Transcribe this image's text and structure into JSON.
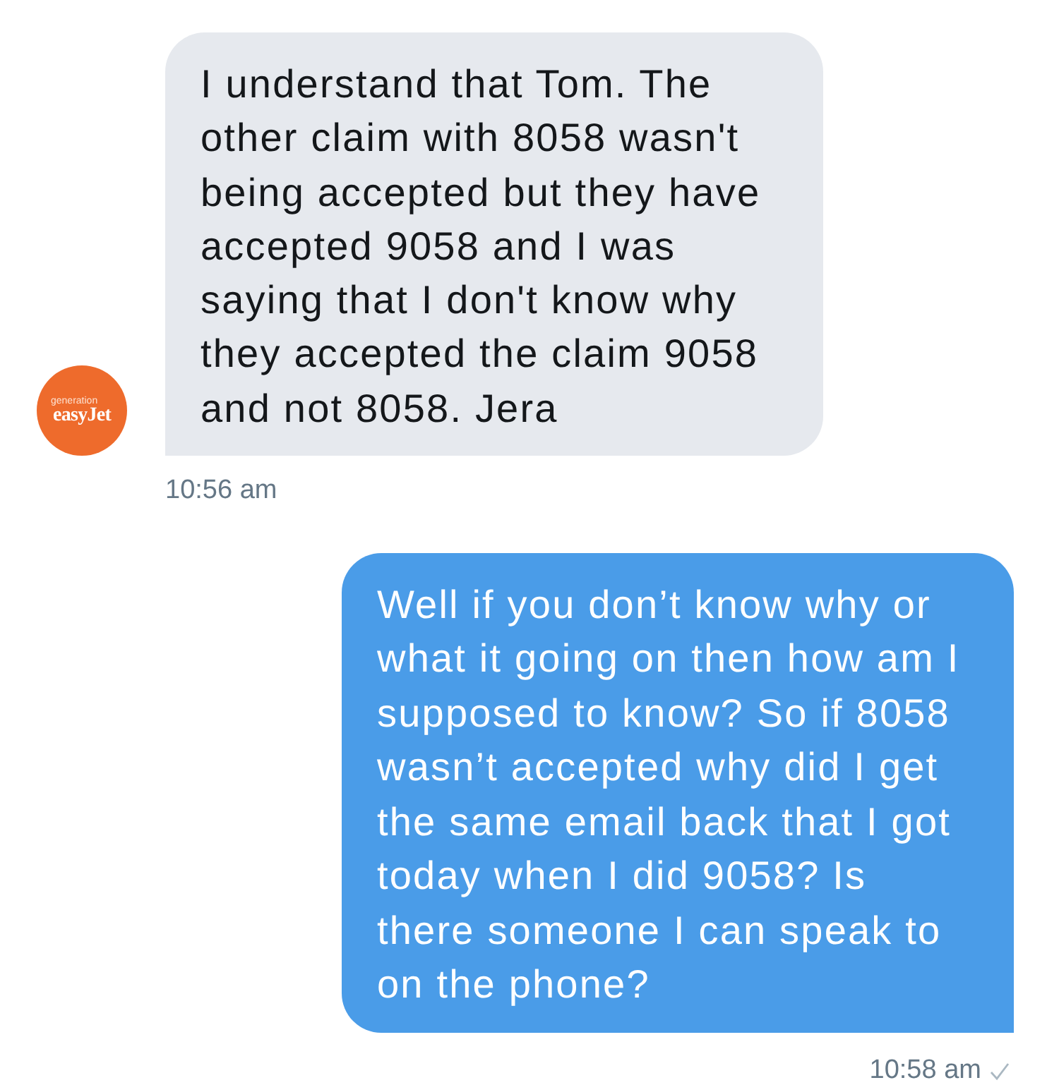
{
  "conversation": {
    "messages": [
      {
        "kind": "received",
        "text": "I understand that Tom. The other claim with 8058 wasn't being accepted but they have accepted 9058 and I was saying that I don't know why they accepted the claim 9058 and not 8058. Jera",
        "time": "10:56 am",
        "avatar": {
          "lines": [
            "generation",
            "easyJet"
          ]
        }
      },
      {
        "kind": "sent",
        "text": "Well if you don’t know why or what it going on then how am I supposed to know? So if 8058 wasn’t accepted why did I get the same email back that I got today when I did 9058? Is there someone I can speak to on the phone?",
        "time": "10:58 am",
        "delivered": true
      }
    ]
  }
}
